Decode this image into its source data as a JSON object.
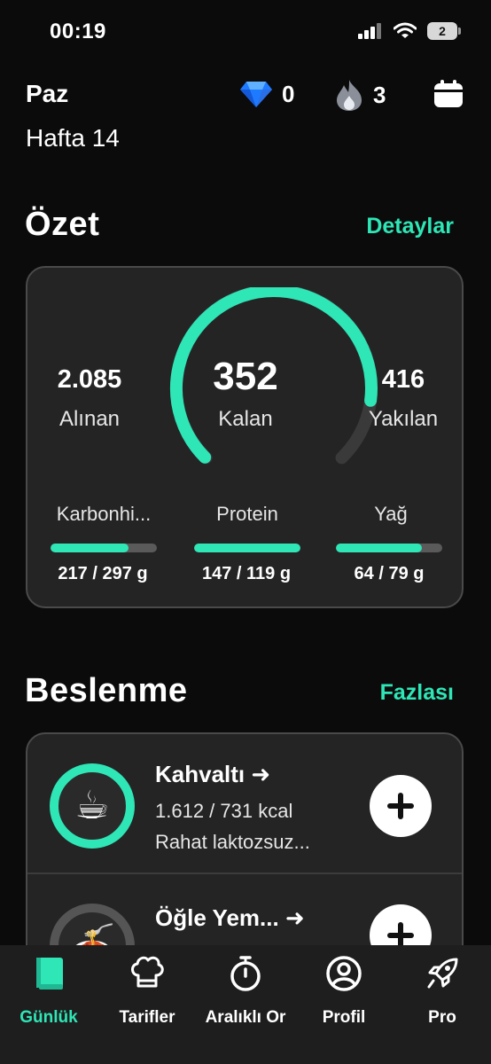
{
  "status_bar": {
    "time": "00:19",
    "battery": "2"
  },
  "header": {
    "day": "Paz",
    "week": "Hafta 14",
    "gems": "0",
    "streak": "3"
  },
  "summary": {
    "title": "Özet",
    "link": "Detaylar",
    "eaten_value": "2.085",
    "eaten_label": "Alınan",
    "remaining_value": "352",
    "remaining_label": "Kalan",
    "burned_value": "416",
    "burned_label": "Yakılan",
    "gauge_progress": 0.86,
    "macros": [
      {
        "name": "Karbonhi...",
        "value": "217 / 297 g",
        "progress": 0.73
      },
      {
        "name": "Protein",
        "value": "147 / 119 g",
        "progress": 1.0
      },
      {
        "name": "Yağ",
        "value": "64 / 79 g",
        "progress": 0.81
      }
    ]
  },
  "nutrition": {
    "title": "Beslenme",
    "link": "Fazlası",
    "meals": [
      {
        "title": "Kahvaltı ➜",
        "kcal": "1.612 / 731 kcal",
        "desc": "Rahat laktozsuz...",
        "emoji": "☕"
      },
      {
        "title": "Öğle Yem... ➜",
        "kcal": "",
        "desc": "",
        "emoji": "🍝"
      }
    ]
  },
  "tabs": [
    {
      "label": "Günlük",
      "active": true
    },
    {
      "label": "Tarifler",
      "active": false
    },
    {
      "label": "Aralıklı Or",
      "active": false
    },
    {
      "label": "Profil",
      "active": false
    },
    {
      "label": "Pro",
      "active": false
    }
  ],
  "colors": {
    "accent": "#2ee6b6",
    "card": "#242424",
    "background": "#0b0b0b"
  }
}
